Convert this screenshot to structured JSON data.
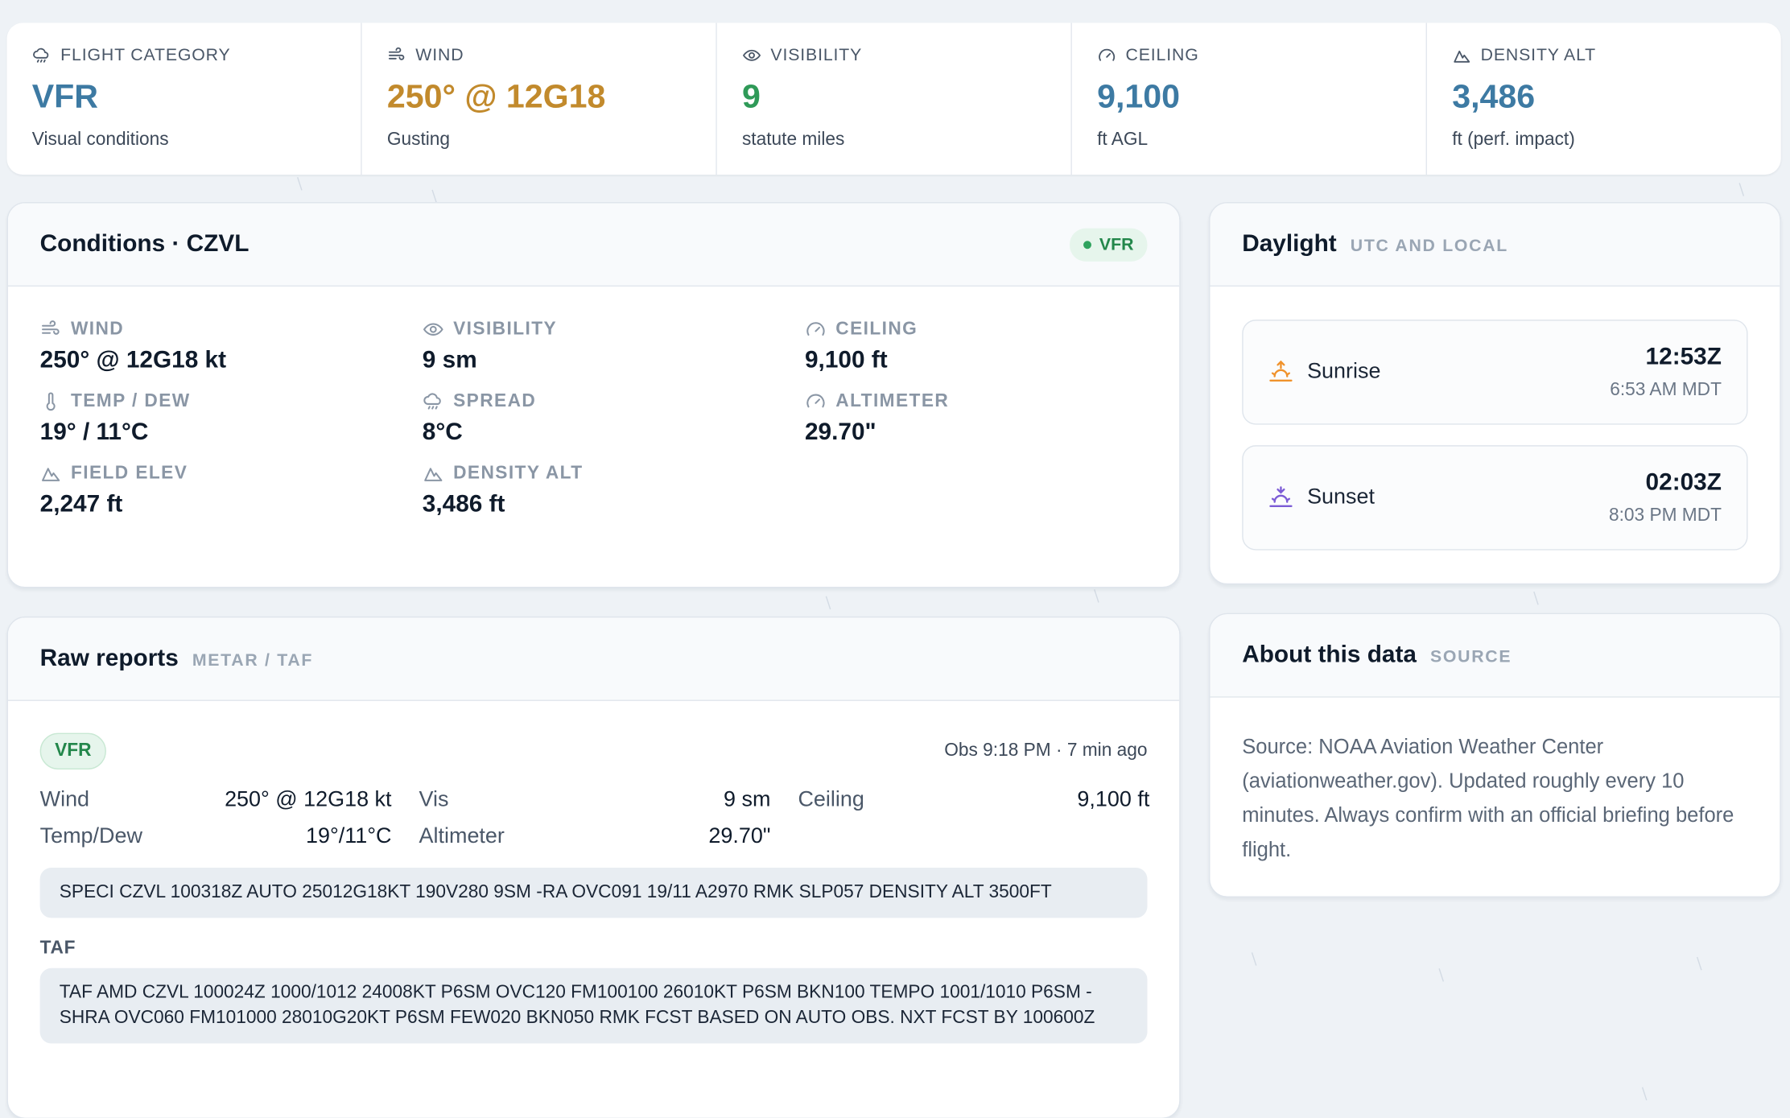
{
  "stats": [
    {
      "label": "FLIGHT CATEGORY",
      "value": "VFR",
      "sub": "Visual conditions",
      "icon": "cloud-rain-icon"
    },
    {
      "label": "WIND",
      "value": "250° @ 12G18",
      "sub": "Gusting",
      "icon": "wind-icon"
    },
    {
      "label": "VISIBILITY",
      "value": "9",
      "sub": "statute miles",
      "icon": "eye-icon"
    },
    {
      "label": "CEILING",
      "value": "9,100",
      "sub": "ft AGL",
      "icon": "gauge-icon"
    },
    {
      "label": "DENSITY ALT",
      "value": "3,486",
      "sub": "ft (perf. impact)",
      "icon": "mountain-icon"
    }
  ],
  "conditions": {
    "title": "Conditions · CZVL",
    "badge": "VFR",
    "cells": [
      {
        "label": "WIND",
        "value": "250° @ 12G18 kt"
      },
      {
        "label": "VISIBILITY",
        "value": "9 sm"
      },
      {
        "label": "CEILING",
        "value": "9,100 ft"
      },
      {
        "label": "TEMP / DEW",
        "value": "19° / 11°C"
      },
      {
        "label": "SPREAD",
        "value": "8°C"
      },
      {
        "label": "ALTIMETER",
        "value": "29.70\""
      },
      {
        "label": "FIELD ELEV",
        "value": "2,247 ft"
      },
      {
        "label": "DENSITY ALT",
        "value": "3,486 ft"
      }
    ]
  },
  "daylight": {
    "title": "Daylight",
    "tag": "UTC AND LOCAL",
    "sunrise": {
      "name": "Sunrise",
      "z": "12:53Z",
      "local": "6:53 AM MDT"
    },
    "sunset": {
      "name": "Sunset",
      "z": "02:03Z",
      "local": "8:03 PM MDT"
    }
  },
  "raw": {
    "title": "Raw reports",
    "tag": "METAR / TAF",
    "pill": "VFR",
    "obs": "Obs 9:18 PM · 7 min ago",
    "wind_k": "Wind",
    "wind_v": "250° @ 12G18 kt",
    "vis_k": "Vis",
    "vis_v": "9 sm",
    "ceil_k": "Ceiling",
    "ceil_v": "9,100 ft",
    "temp_k": "Temp/Dew",
    "temp_v": "19°/11°C",
    "alt_k": "Altimeter",
    "alt_v": "29.70\"",
    "metar": "SPECI CZVL 100318Z AUTO 25012G18KT 190V280 9SM -RA OVC091 19/11 A2970 RMK SLP057 DENSITY ALT 3500FT",
    "taf_label": "TAF",
    "taf": "TAF AMD CZVL 100024Z 1000/1012 24008KT P6SM OVC120 FM100100 26010KT P6SM BKN100 TEMPO 1001/1010 P6SM -SHRA OVC060 FM101000 28010G20KT P6SM FEW020 BKN050 RMK FCST BASED ON AUTO OBS. NXT FCST BY 100600Z"
  },
  "about": {
    "title": "About this data",
    "tag": "SOURCE",
    "text": "Source: NOAA Aviation Weather Center (aviationweather.gov). Updated roughly every 10 minutes. Always confirm with an official briefing before flight."
  },
  "colors": {
    "vfr_blue": "#3d7aa3",
    "wind_amber": "#c28a2c",
    "vis_green": "#2f9a58",
    "sunrise_orange": "#f0922b",
    "sunset_purple": "#7c5cd6"
  }
}
